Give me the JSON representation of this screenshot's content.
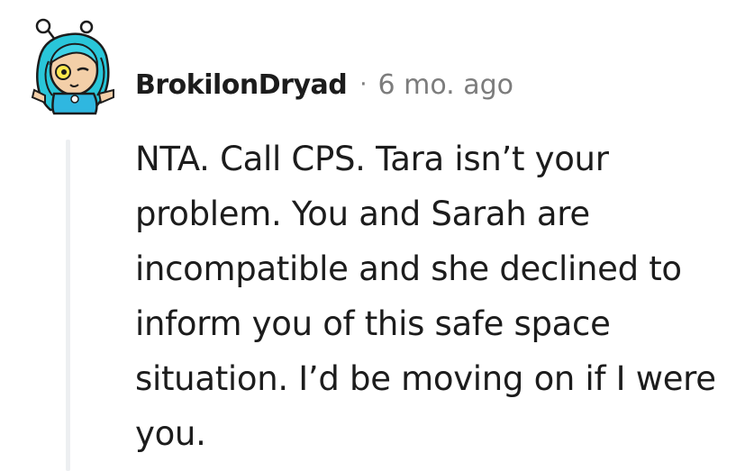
{
  "comment": {
    "author": "BrokilonDryad",
    "separator": "·",
    "timestamp": "6 mo. ago",
    "body": "NTA. Call CPS. Tara isn’t your problem. You and Sarah are incompatible and she declined to inform you of this safe space situation. I’d be moving on if I were you.",
    "avatar_icon": "snoo-avatar-icon",
    "colors": {
      "text": "#1c1c1c",
      "meta": "#7c7c7c",
      "thread_line": "#edeff1",
      "avatar_hair": "#29c6d9",
      "avatar_skin": "#f3cfa8"
    }
  }
}
